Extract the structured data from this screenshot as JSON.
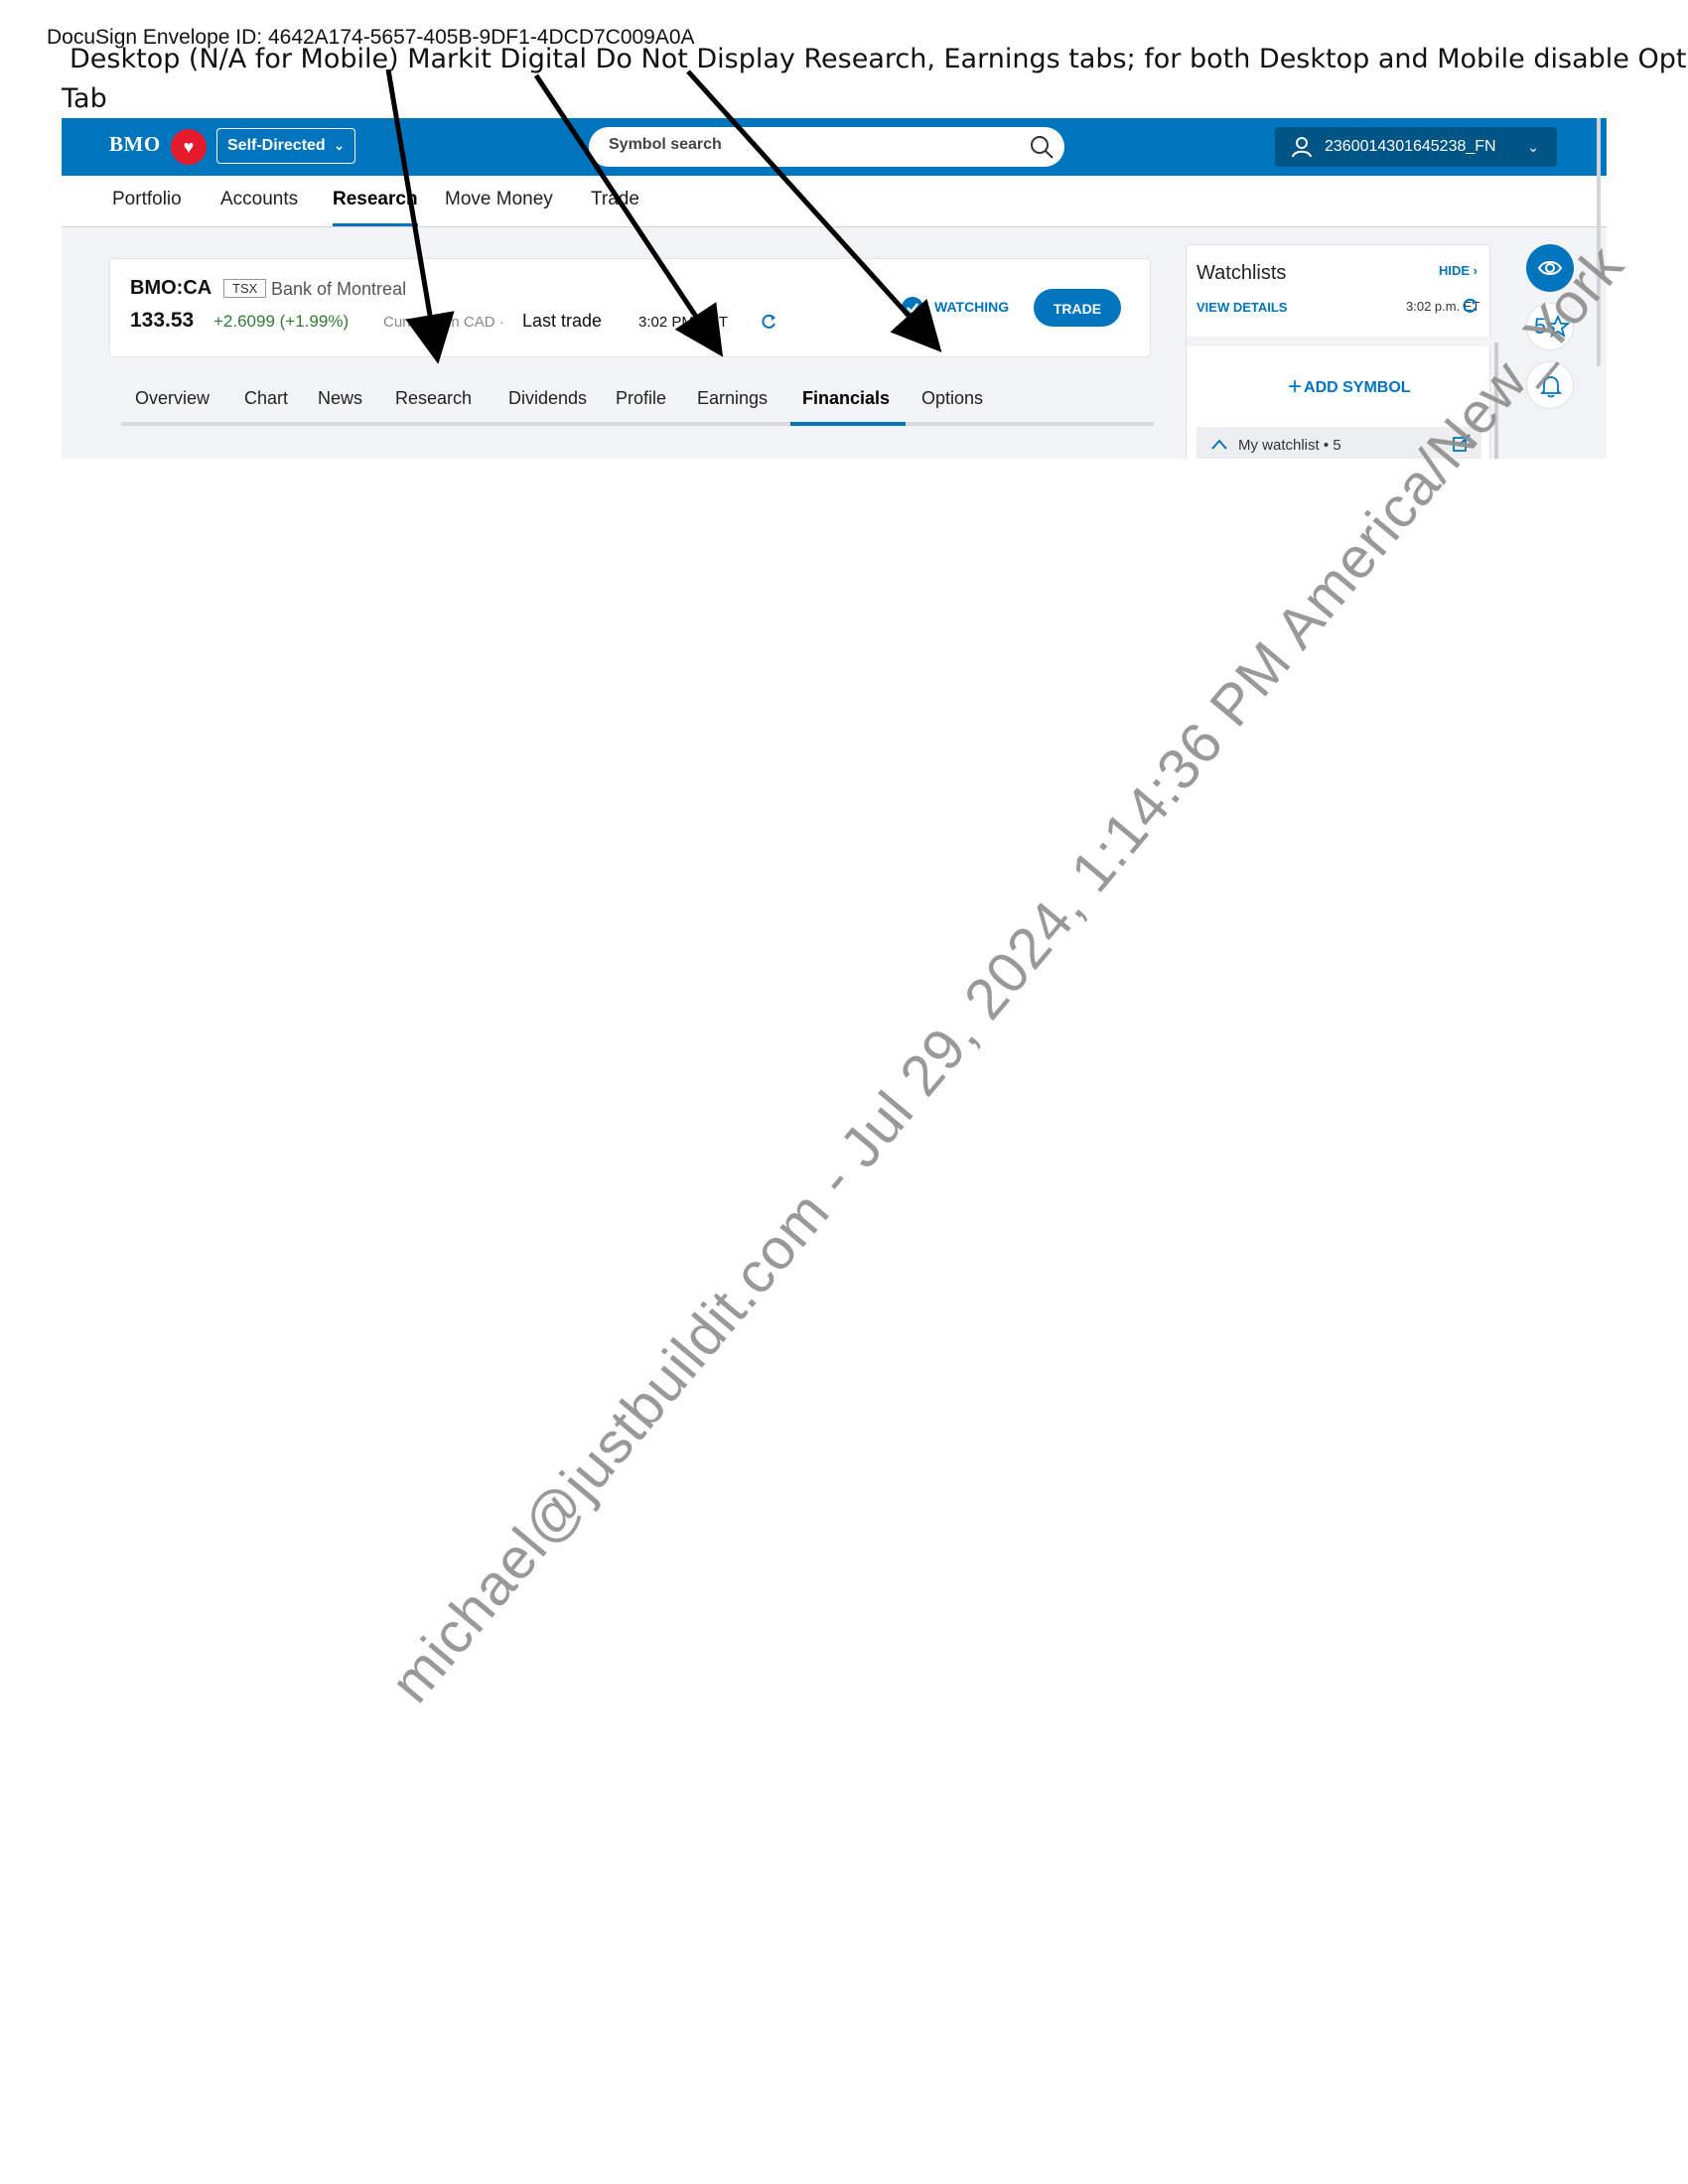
{
  "document": {
    "envelope_id": "DocuSign Envelope ID: 4642A174-5657-405B-9DF1-4DCD7C009A0A",
    "instruction_line1": "Desktop (N/A for Mobile) Markit Digital Do Not Display Research, Earnings tabs; for both Desktop and Mobile disable Options",
    "instruction_line2": "Tab",
    "watermark": "michael@justbuildit.com - Jul 29, 2024, 1:14:36 PM America/New_York"
  },
  "header": {
    "logo": "BMO",
    "logo_icon": "bmo-roundel-icon",
    "mode_label": "Self-Directed",
    "search_placeholder": "Symbol search",
    "account_id": "2360014301645238_FN"
  },
  "main_nav": {
    "items": [
      "Portfolio",
      "Accounts",
      "Research",
      "Move Money",
      "Trade"
    ],
    "active": "Research"
  },
  "quote": {
    "symbol": "BMO:CA",
    "exchange": "TSX",
    "company": "Bank of Montreal",
    "price": "133.53",
    "change": "+2.6099 (+1.99%)",
    "currency_note": "Currency in CAD ·",
    "last_trade_label": "Last trade",
    "last_trade_time": "3:02 PM EDT",
    "watching_label": "WATCHING",
    "trade_label": "TRADE",
    "colors": {
      "accent": "#0075be",
      "positive": "#2e7d32"
    }
  },
  "sub_tabs": {
    "items": [
      "Overview",
      "Chart",
      "News",
      "Research",
      "Dividends",
      "Profile",
      "Earnings",
      "Financials",
      "Options"
    ],
    "active": "Financials"
  },
  "watchlists": {
    "title": "Watchlists",
    "hide_label": "HIDE",
    "view_details": "VIEW DETAILS",
    "time": "3:02 p.m. ET",
    "add_symbol": "ADD SYMBOL",
    "list_name": "My watchlist",
    "list_count": "• 5"
  },
  "side_buttons": {
    "star_count": "5"
  }
}
